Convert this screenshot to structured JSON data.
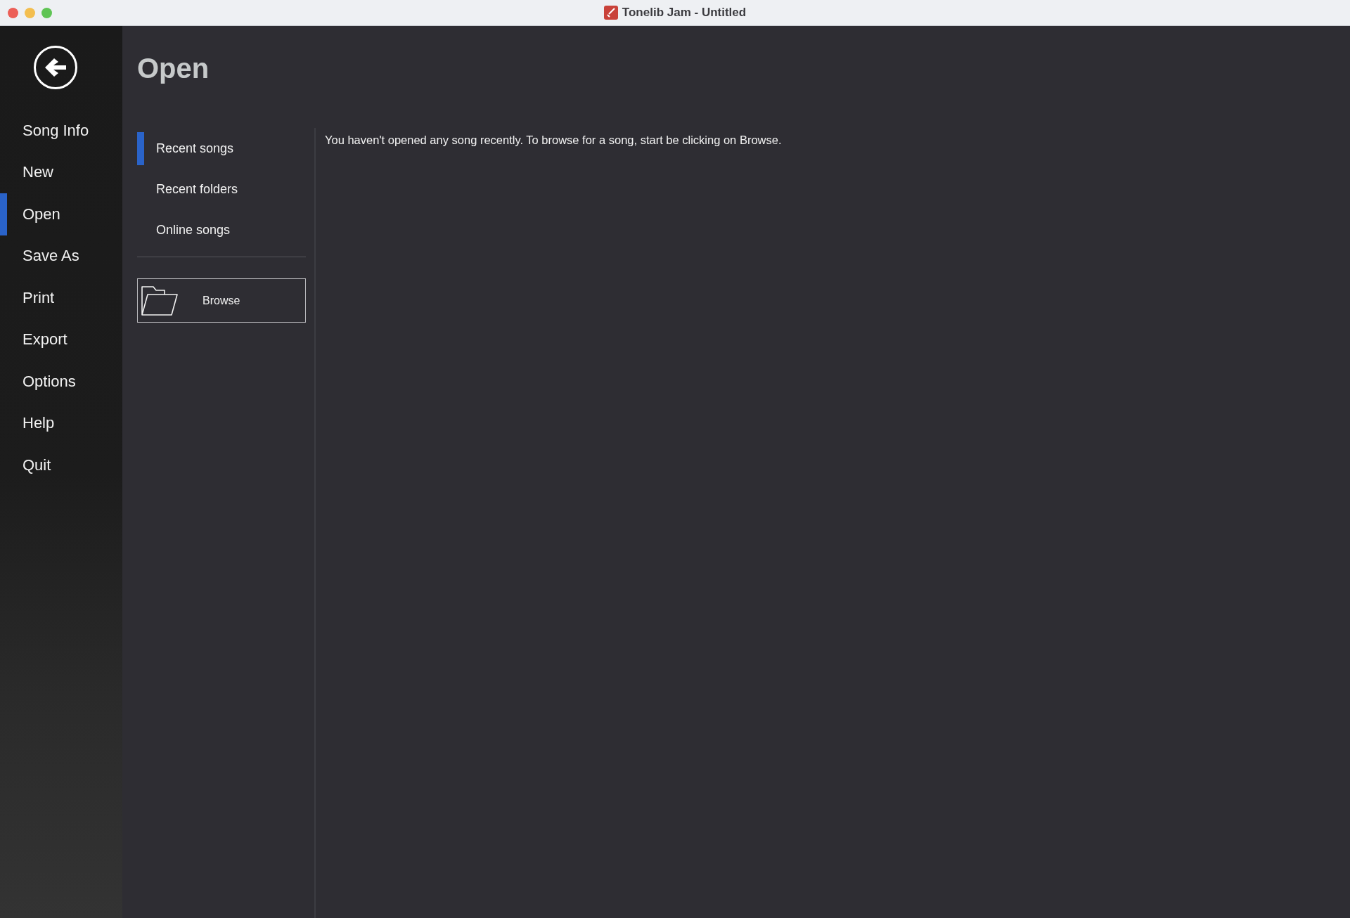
{
  "window": {
    "title": "Tonelib Jam - Untitled"
  },
  "sidebar": {
    "items": [
      {
        "label": "Song Info",
        "selected": false
      },
      {
        "label": "New",
        "selected": false
      },
      {
        "label": "Open",
        "selected": true
      },
      {
        "label": "Save As",
        "selected": false
      },
      {
        "label": "Print",
        "selected": false
      },
      {
        "label": "Export",
        "selected": false
      },
      {
        "label": "Options",
        "selected": false
      },
      {
        "label": "Help",
        "selected": false
      },
      {
        "label": "Quit",
        "selected": false
      }
    ]
  },
  "page": {
    "title": "Open"
  },
  "open_sources": [
    {
      "label": "Recent songs",
      "selected": true
    },
    {
      "label": "Recent folders",
      "selected": false
    },
    {
      "label": "Online songs",
      "selected": false
    }
  ],
  "browse_button": {
    "label": "Browse"
  },
  "message": "You haven't opened any song recently. To browse for a song, start be clicking on Browse."
}
